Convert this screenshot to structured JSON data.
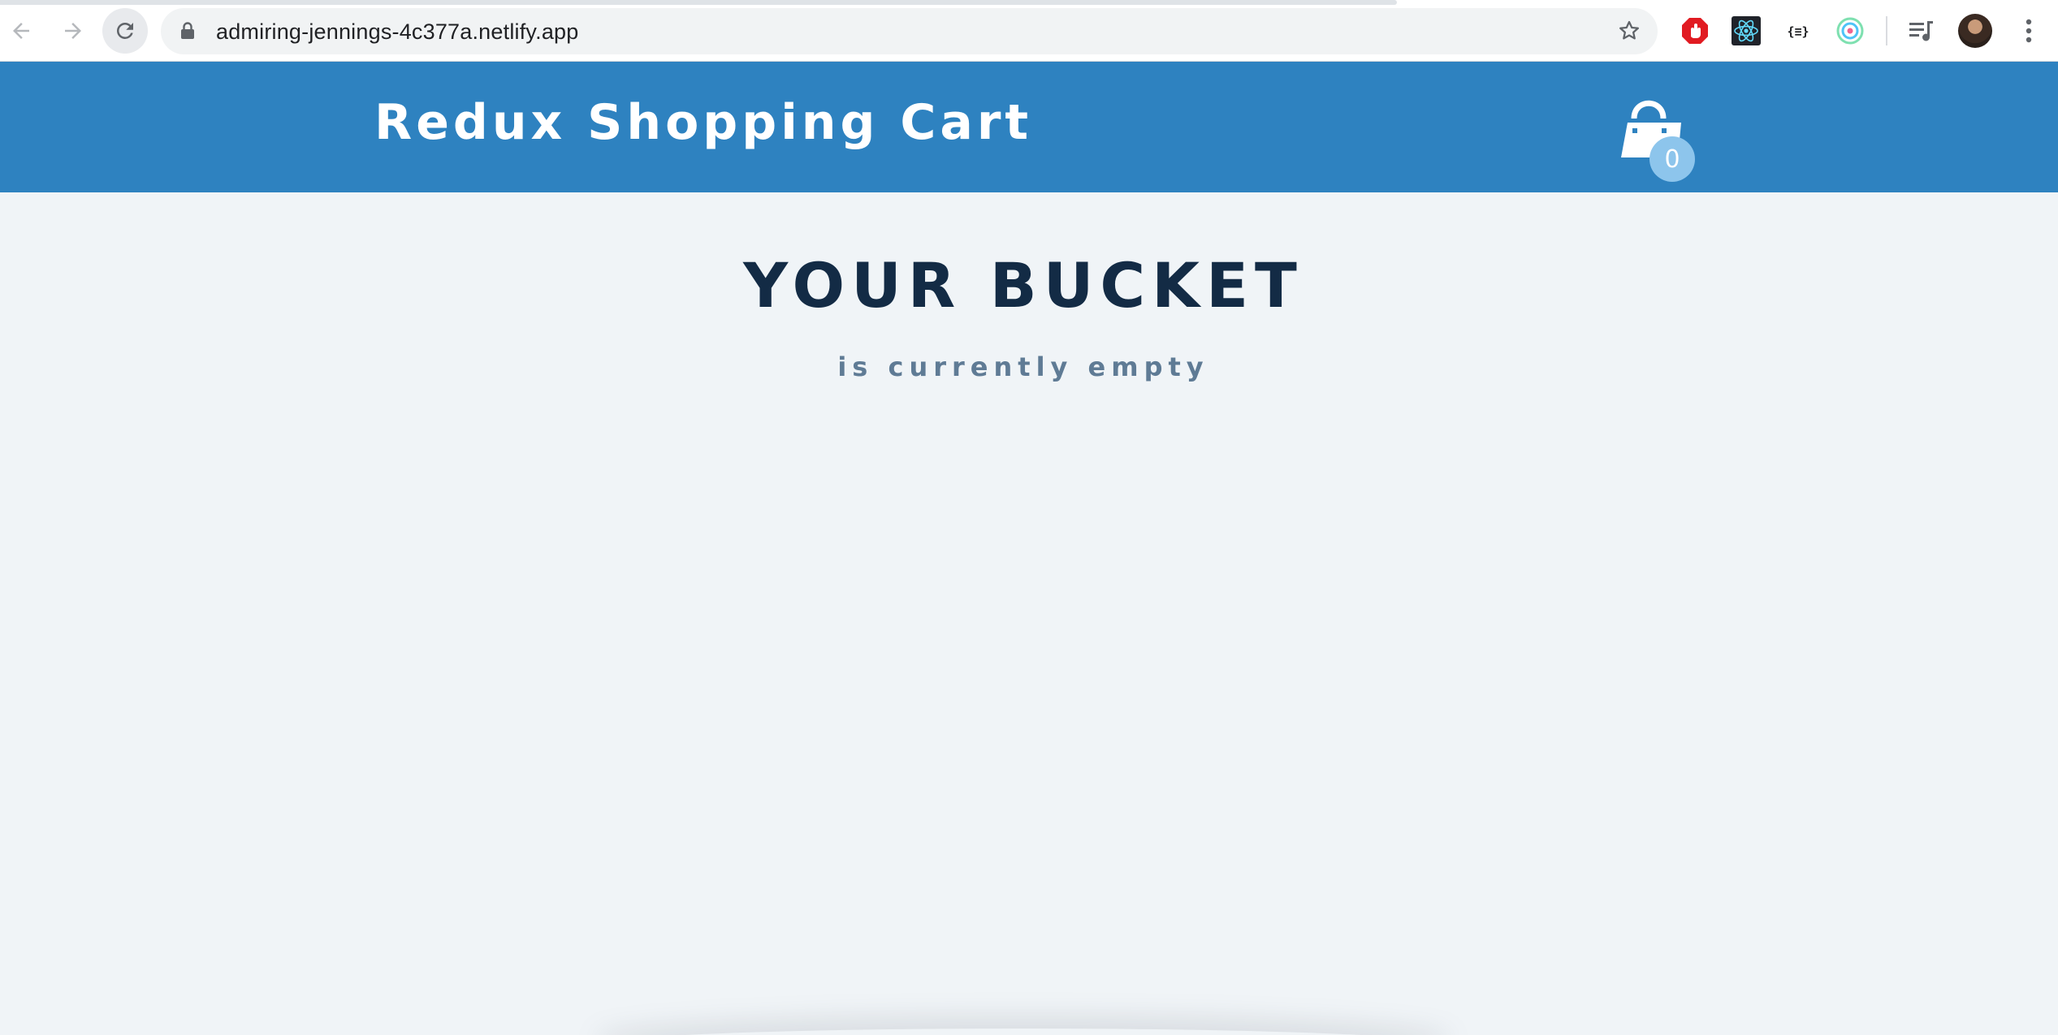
{
  "browser": {
    "url": "admiring-jennings-4c377a.netlify.app",
    "extensions": [
      "adblock-icon",
      "react-devtools-icon",
      "json-viewer-icon",
      "colorzilla-icon"
    ]
  },
  "header": {
    "title": "Redux Shopping Cart",
    "cart_count": "0"
  },
  "main": {
    "title": "YOUR BUCKET",
    "subtitle": "is currently empty"
  },
  "colors": {
    "header_bg": "#2e82c0",
    "page_bg": "#f0f4f7",
    "title_text": "#132b45",
    "subtitle_text": "#5f7b95",
    "badge_bg": "#8dc5ec"
  }
}
